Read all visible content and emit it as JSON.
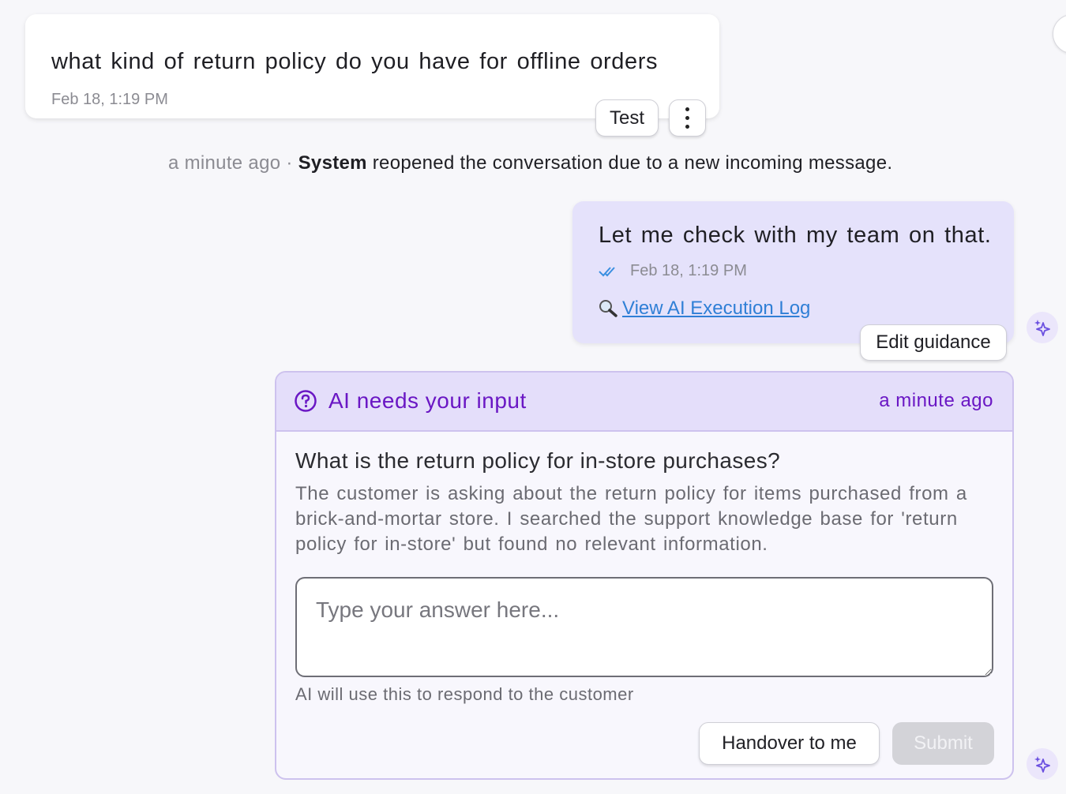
{
  "incoming_message": {
    "text": "what kind of return policy do you have for offline orders",
    "time": "Feb 18, 1:19 PM",
    "test_label": "Test",
    "more_icon": "more-vertical-icon"
  },
  "system_event": {
    "time": "a minute ago",
    "separator": " · ",
    "actor": "System",
    "text": " reopened the conversation due to a new incoming message."
  },
  "outgoing_message": {
    "text": "Let me check with my team on that.",
    "status_icon": "double-check-icon",
    "time": "Feb 18, 1:19 PM",
    "log_icon": "magnifier-icon",
    "log_link": "View AI Execution Log",
    "edit_guidance_label": "Edit guidance"
  },
  "ai_input_card": {
    "title": "AI needs your input",
    "title_icon": "question-circle-icon",
    "time": "a minute ago",
    "question": "What is the return policy for in-store purchases?",
    "description": "The customer is asking about the return policy for items purchased from a brick-and-mortar store. I searched the support knowledge base for 'return policy for in-store' but found no relevant information.",
    "answer_placeholder": "Type your answer here...",
    "hint": "AI will use this to respond to the customer",
    "handover_label": "Handover to me",
    "submit_label": "Submit"
  },
  "colors": {
    "accent": "#6a17c4",
    "outgoing_bg": "#e5e2fb",
    "card_header_bg": "#e4defa",
    "link": "#2f7fd6",
    "disabled": "#d3d3d8"
  }
}
